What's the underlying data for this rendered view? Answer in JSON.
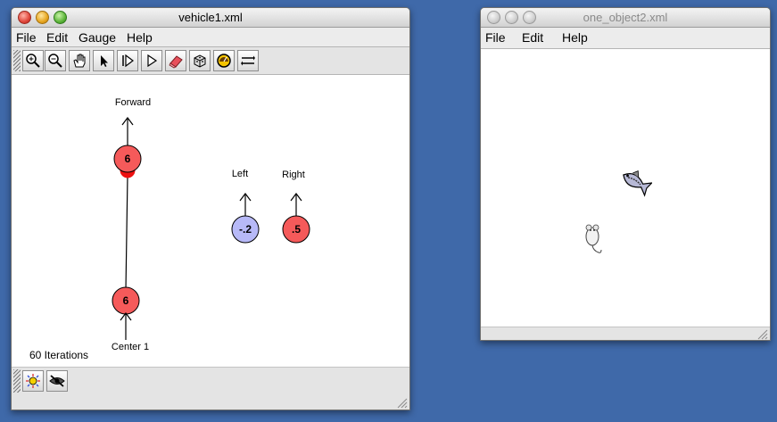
{
  "windows": {
    "vehicle": {
      "title": "vehicle1.xml",
      "menu": [
        "File",
        "Edit",
        "Gauge",
        "Help"
      ],
      "toolbar_icons": [
        "zoom-in-icon",
        "zoom-out-icon",
        "hand-pan-icon",
        "arrow-pointer-icon",
        "step-forward-icon",
        "play-icon",
        "eraser-icon",
        "cube-icon",
        "gauge-icon",
        "swap-arrows-icon"
      ],
      "status": "60 Iterations",
      "bottom_icons": [
        "sun-brain-icon",
        "hide-eye-icon"
      ],
      "network": {
        "node_colors": {
          "excitatory": "#f55a5a",
          "inhibitory": "#b7b9f7"
        },
        "nodes": [
          {
            "id": "forward",
            "label": "Forward",
            "value": "6",
            "type": "excitatory"
          },
          {
            "id": "center",
            "label": "Center 1",
            "value": "6",
            "type": "excitatory"
          },
          {
            "id": "left",
            "label": "Left",
            "value": "-.2",
            "type": "inhibitory"
          },
          {
            "id": "right",
            "label": "Right",
            "value": ".5",
            "type": "excitatory"
          }
        ]
      }
    },
    "world": {
      "title": "one_object2.xml",
      "menu": [
        "File",
        "Edit",
        "Help"
      ],
      "objects": [
        "fish-icon",
        "mouse-icon"
      ]
    }
  }
}
